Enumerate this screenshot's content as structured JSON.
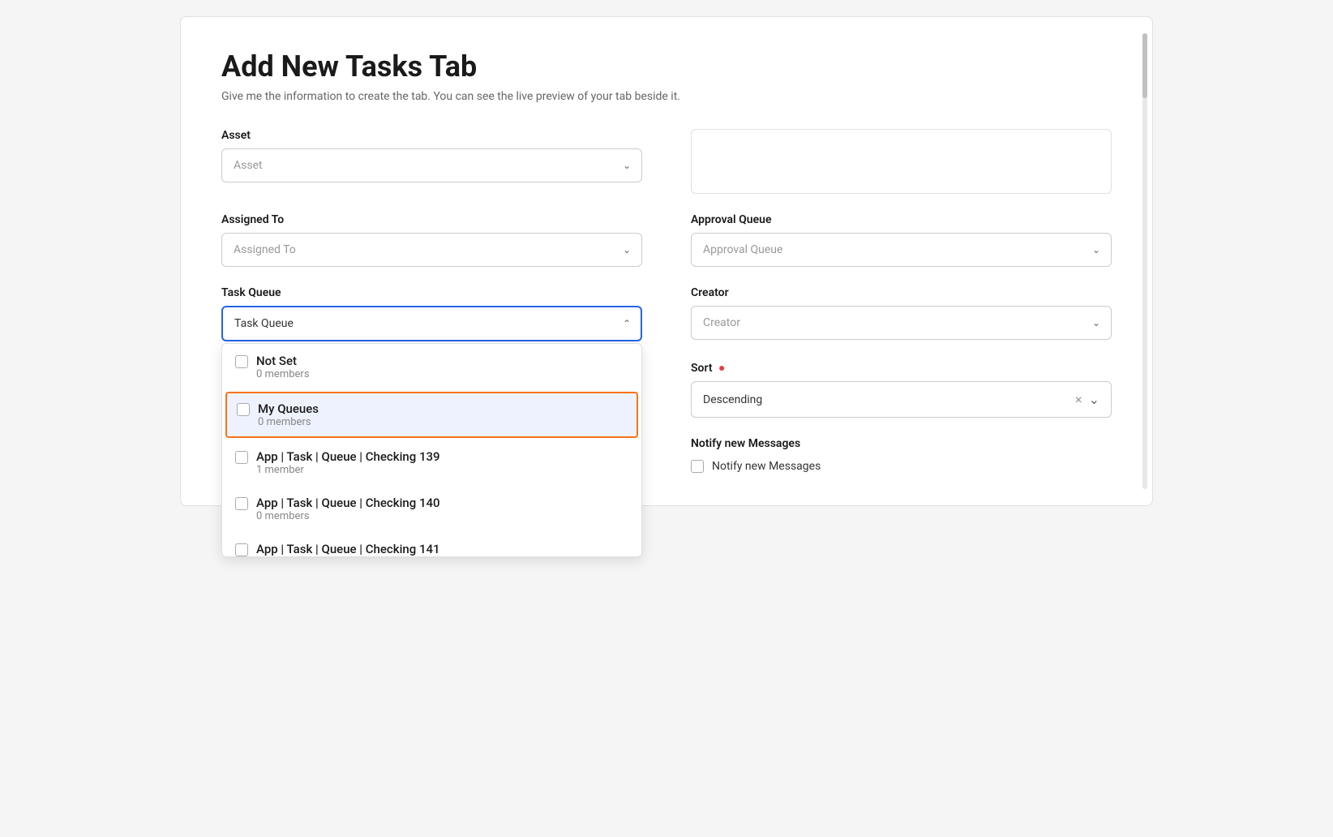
{
  "page": {
    "title": "Add New Tasks Tab",
    "subtitle": "Give me the information to create the tab. You can see the live preview of your tab beside it."
  },
  "form": {
    "asset": {
      "label": "Asset",
      "placeholder": "Asset"
    },
    "preview": {
      "label": ""
    },
    "assigned_to": {
      "label": "Assigned To",
      "placeholder": "Assigned To"
    },
    "approval_queue": {
      "label": "Approval Queue",
      "placeholder": "Approval Queue"
    },
    "task_queue": {
      "label": "Task Queue",
      "placeholder": "Task Queue"
    },
    "creator": {
      "label": "Creator",
      "placeholder": "Creator"
    },
    "sort": {
      "label": "Sort",
      "required": true,
      "value": "Descending"
    },
    "notify": {
      "label": "Notify new Messages",
      "checkbox_label": "Notify new Messages"
    }
  },
  "dropdown": {
    "items": [
      {
        "name": "Not Set",
        "sub": "0 members",
        "highlighted": false
      },
      {
        "name": "My Queues",
        "sub": "0 members",
        "highlighted": true
      },
      {
        "name": "App | Task | Queue | Checking 139",
        "sub": "1 member",
        "highlighted": false
      },
      {
        "name": "App | Task | Queue | Checking 140",
        "sub": "0 members",
        "highlighted": false
      },
      {
        "name": "App | Task | Queue | Checking 141",
        "sub": "",
        "highlighted": false
      }
    ]
  },
  "icons": {
    "chevron_down": "&#8964;",
    "chevron_up": "&#8963;",
    "close": "×"
  }
}
